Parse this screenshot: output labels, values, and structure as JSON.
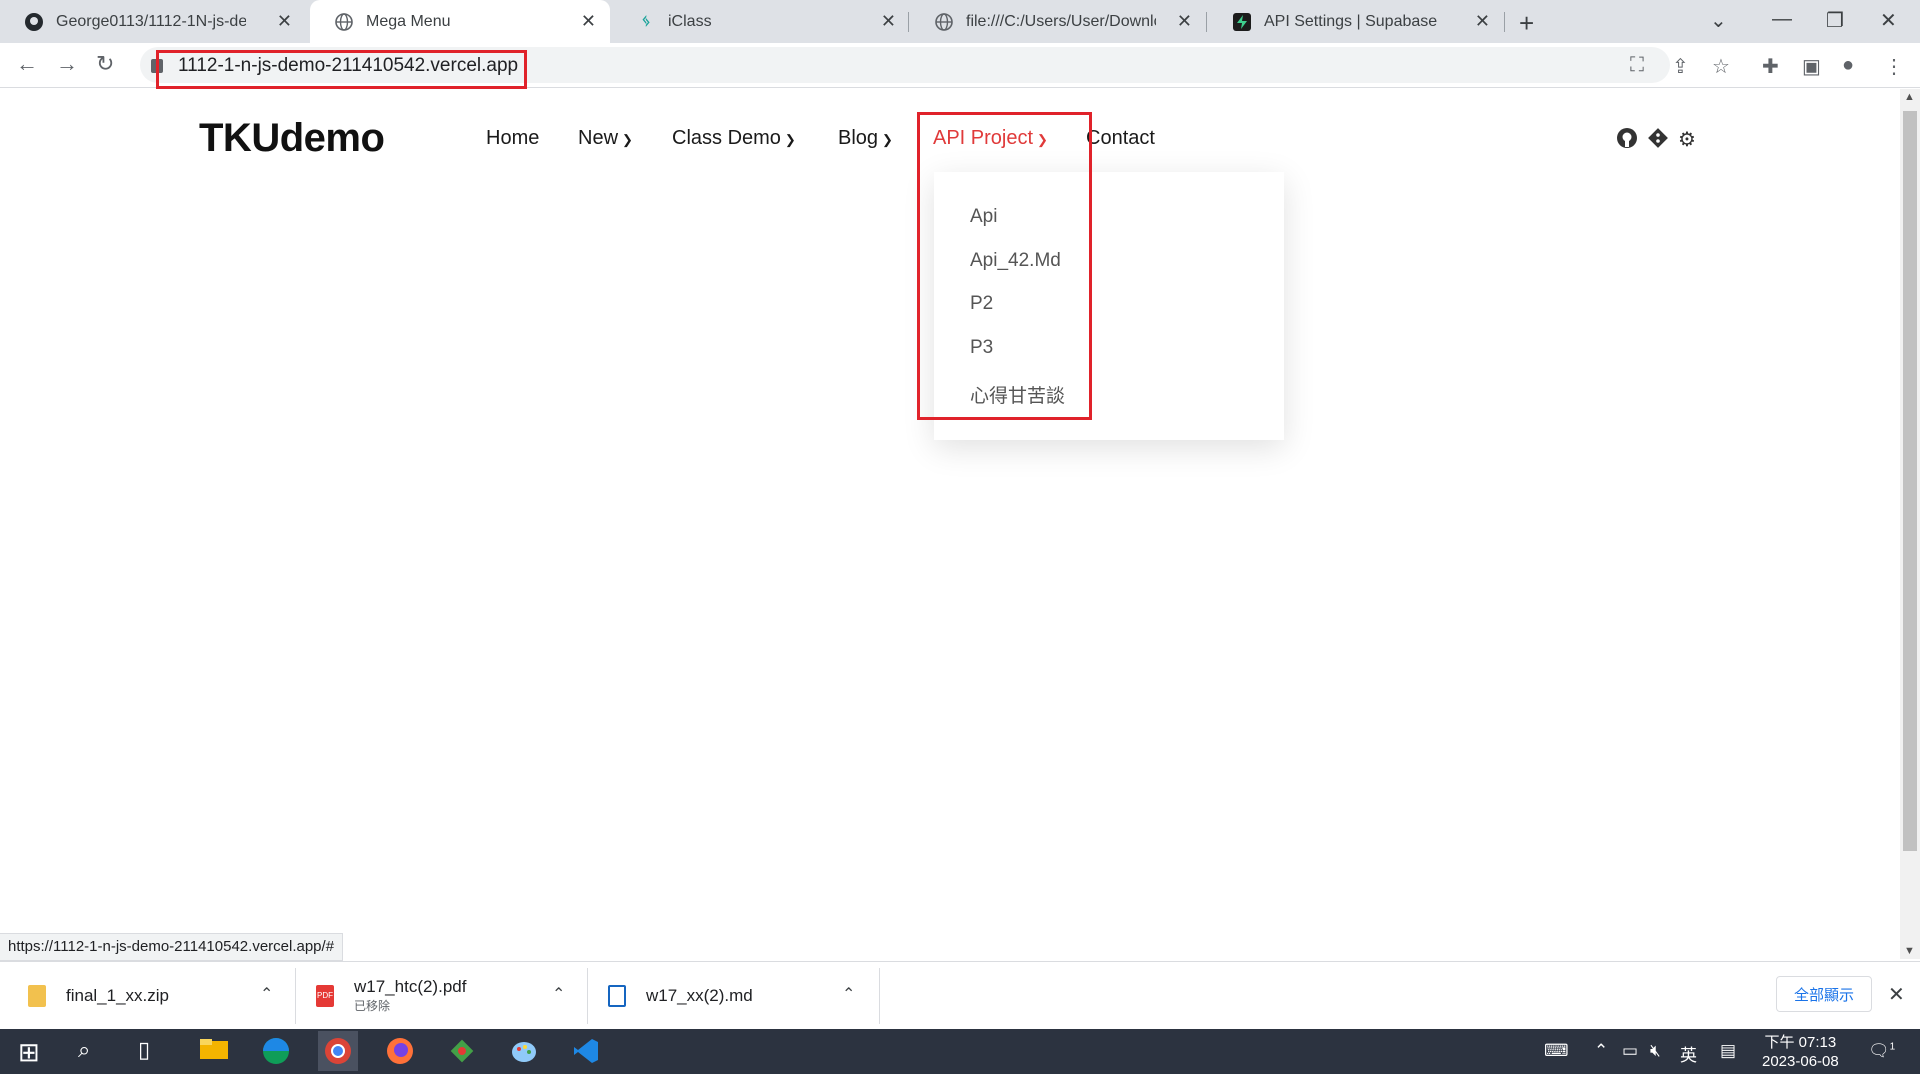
{
  "browser": {
    "tabs": [
      {
        "title": "George0113/1112-1N-js-demo",
        "icon": "github-icon"
      },
      {
        "title": "Mega Menu",
        "icon": "globe-icon"
      },
      {
        "title": "iClass",
        "icon": "iclass-icon"
      },
      {
        "title": "file:///C:/Users/User/Downloads",
        "icon": "globe-icon"
      },
      {
        "title": "API Settings | Supabase",
        "icon": "supabase-icon"
      }
    ],
    "url": "1112-1-n-js-demo-211410542.vercel.app",
    "status_url": "https://1112-1-n-js-demo-211410542.vercel.app/#"
  },
  "site": {
    "logo": "TKUdemo",
    "nav": [
      "Home",
      "New",
      "Class Demo",
      "Blog",
      "API Project",
      "Contact"
    ],
    "dropdown": [
      "Api",
      "Api_42.Md",
      "P2",
      "P3",
      "心得甘苦談"
    ]
  },
  "downloads": [
    {
      "name": "final_1_xx.zip",
      "sub": ""
    },
    {
      "name": "w17_htc(2).pdf",
      "sub": "已移除"
    },
    {
      "name": "w17_xx(2).md",
      "sub": ""
    }
  ],
  "downloads_show_all": "全部顯示",
  "taskbar": {
    "ime": "英",
    "time": "下午 07:13",
    "date": "2023-06-08",
    "notification_count": "1"
  },
  "colors": {
    "accent": "#e03a3a",
    "highlight_box": "#e0222a"
  }
}
